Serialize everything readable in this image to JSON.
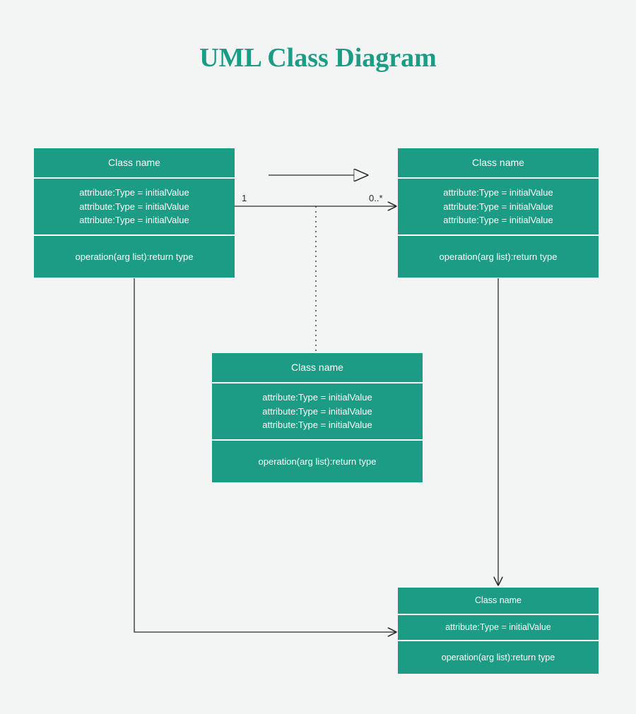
{
  "title": "UML Class Diagram",
  "colors": {
    "primary": "#1c9c84",
    "bg": "#f3f4f4",
    "stroke": "#2b2b2b"
  },
  "classes": {
    "c1": {
      "name": "Class name",
      "attr1": "attribute:Type = initialValue",
      "attr2": "attribute:Type = initialValue",
      "attr3": "attribute:Type = initialValue",
      "op": "operation(arg list):return type"
    },
    "c2": {
      "name": "Class name",
      "attr1": "attribute:Type = initialValue",
      "attr2": "attribute:Type = initialValue",
      "attr3": "attribute:Type = initialValue",
      "op": "operation(arg list):return type"
    },
    "c3": {
      "name": "Class name",
      "attr1": "attribute:Type = initialValue",
      "attr2": "attribute:Type = initialValue",
      "attr3": "attribute:Type = initialValue",
      "op": "operation(arg list):return type"
    },
    "c4": {
      "name": "Class name",
      "attr1": "attribute:Type = initialValue",
      "op": "operation(arg list):return type"
    }
  },
  "association": {
    "mult_left": "1",
    "mult_right": "0..*"
  }
}
